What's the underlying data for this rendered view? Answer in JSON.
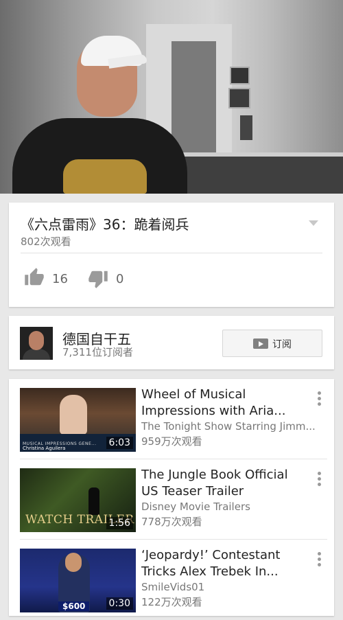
{
  "video": {
    "title": "《六点雷雨》36：跪着阅兵",
    "views": "802次观看",
    "likes": "16",
    "dislikes": "0"
  },
  "channel": {
    "name": "德国自干五",
    "subscribers": "7,311位订阅者",
    "subscribe_label": "订阅"
  },
  "recommended": [
    {
      "title_line1": "Wheel of Musical",
      "title_line2": "Impressions with Aria...",
      "channel": "The Tonight Show Starring Jimm...",
      "views": "959万次观看",
      "duration": "6:03",
      "thumb_text": "MUSICAL IMPRESSIONS GENE...",
      "thumb_name": "Christina Aguilera"
    },
    {
      "title_line1": "The Jungle Book Official",
      "title_line2": "US Teaser Trailer",
      "channel": "Disney Movie Trailers",
      "views": "778万次观看",
      "duration": "1:56",
      "thumb_text": "WATCH TRAILER"
    },
    {
      "title_line1": "‘Jeopardy!’ Contestant",
      "title_line2": "Tricks Alex Trebek In...",
      "channel": "SmileVids01",
      "views": "122万次观看",
      "duration": "0:30",
      "thumb_text": "$600"
    }
  ],
  "icons": {
    "like": "thumb-up-icon",
    "dislike": "thumb-down-icon",
    "expand": "chevron-down-icon",
    "subscribe": "youtube-play-icon",
    "more": "more-vert-icon"
  },
  "colors": {
    "background": "#e8e8e8",
    "card": "#ffffff",
    "icon_gray": "#9a9a9a"
  }
}
